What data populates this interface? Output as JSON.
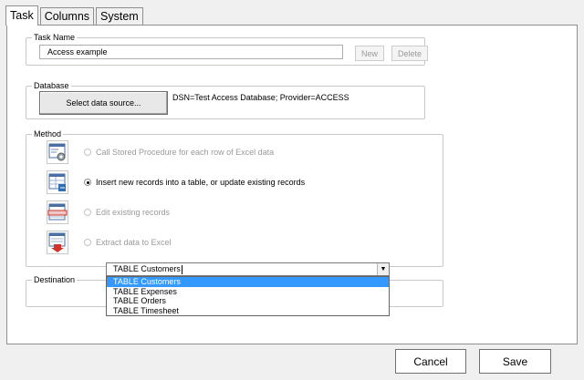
{
  "tabs": [
    {
      "label": "Task"
    },
    {
      "label": "Columns"
    },
    {
      "label": "System"
    }
  ],
  "task_name": {
    "group_title": "Task Name",
    "value": "Access example",
    "new_label": "New",
    "delete_label": "Delete"
  },
  "database": {
    "group_title": "Database",
    "select_label": "Select data source...",
    "connection_text": "DSN=Test Access Database; Provider=ACCESS"
  },
  "method": {
    "group_title": "Method",
    "options": [
      {
        "label": "Call Stored Procedure for each row of Excel data",
        "icon": "stored-procedure-icon",
        "checked": false,
        "enabled": false
      },
      {
        "label": "Insert new records into a table, or update existing records",
        "icon": "insert-records-icon",
        "checked": true,
        "enabled": true
      },
      {
        "label": "Edit existing records",
        "icon": "edit-records-icon",
        "checked": false,
        "enabled": false
      },
      {
        "label": "Extract data to Excel",
        "icon": "extract-data-icon",
        "checked": false,
        "enabled": false
      }
    ]
  },
  "destination": {
    "group_title": "Destination",
    "value": "TABLE Customers",
    "options": [
      "TABLE Customers",
      "TABLE Expenses",
      "TABLE Orders",
      "TABLE Timesheet"
    ],
    "selected_index": 0
  },
  "footer": {
    "cancel_label": "Cancel",
    "save_label": "Save"
  },
  "colors": {
    "selection": "#3399ff",
    "panel": "#ffffff",
    "window": "#f0f0f0"
  }
}
